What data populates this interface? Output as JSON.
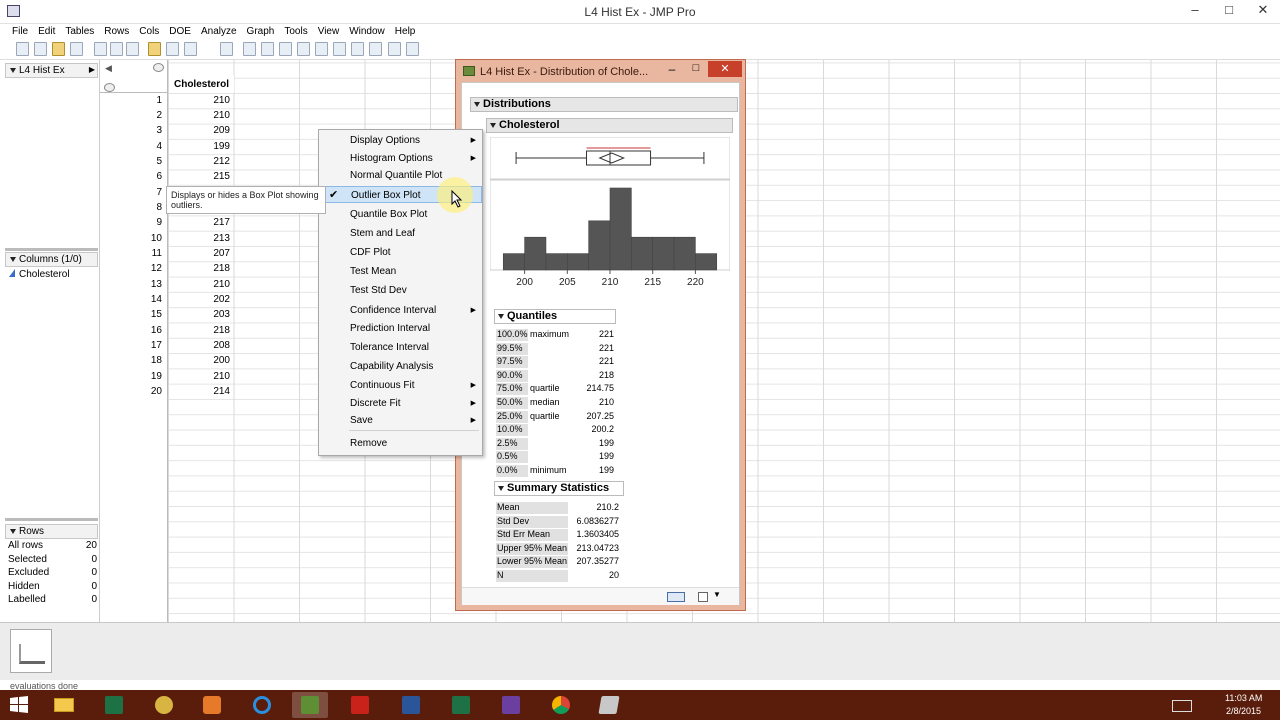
{
  "window": {
    "title": "L4 Hist Ex - JMP Pro"
  },
  "menubar": [
    "File",
    "Edit",
    "Tables",
    "Rows",
    "Cols",
    "DOE",
    "Analyze",
    "Graph",
    "Tools",
    "View",
    "Window",
    "Help"
  ],
  "table_panel": {
    "name": "L4 Hist Ex"
  },
  "columns_panel": {
    "title": "Columns (1/0)",
    "items": [
      "Cholesterol"
    ]
  },
  "rows_panel": {
    "title": "Rows",
    "items": [
      {
        "label": "All rows",
        "value": "20"
      },
      {
        "label": "Selected",
        "value": "0"
      },
      {
        "label": "Excluded",
        "value": "0"
      },
      {
        "label": "Hidden",
        "value": "0"
      },
      {
        "label": "Labelled",
        "value": "0"
      }
    ]
  },
  "datatable": {
    "column": "Cholesterol",
    "rows": [
      "1",
      "2",
      "3",
      "4",
      "5",
      "6",
      "7",
      "8",
      "9",
      "10",
      "11",
      "12",
      "13",
      "14",
      "15",
      "16",
      "17",
      "18",
      "19",
      "20"
    ],
    "values": [
      "210",
      "210",
      "209",
      "199",
      "212",
      "215",
      "",
      "",
      "217",
      "213",
      "207",
      "218",
      "210",
      "202",
      "203",
      "218",
      "208",
      "200",
      "210",
      "214"
    ]
  },
  "dist_window": {
    "title": "L4 Hist Ex - Distribution of Chole...",
    "distributions_label": "Distributions",
    "variable": "Cholesterol",
    "quantiles_title": "Quantiles",
    "quantiles": [
      {
        "p": "100.0%",
        "label": "maximum",
        "value": "221"
      },
      {
        "p": "99.5%",
        "label": "",
        "value": "221"
      },
      {
        "p": "97.5%",
        "label": "",
        "value": "221"
      },
      {
        "p": "90.0%",
        "label": "",
        "value": "218"
      },
      {
        "p": "75.0%",
        "label": "quartile",
        "value": "214.75"
      },
      {
        "p": "50.0%",
        "label": "median",
        "value": "210"
      },
      {
        "p": "25.0%",
        "label": "quartile",
        "value": "207.25"
      },
      {
        "p": "10.0%",
        "label": "",
        "value": "200.2"
      },
      {
        "p": "2.5%",
        "label": "",
        "value": "199"
      },
      {
        "p": "0.5%",
        "label": "",
        "value": "199"
      },
      {
        "p": "0.0%",
        "label": "minimum",
        "value": "199"
      }
    ],
    "summary_title": "Summary Statistics",
    "summary": [
      {
        "k": "Mean",
        "v": "210.2"
      },
      {
        "k": "Std Dev",
        "v": "6.0836277"
      },
      {
        "k": "Std Err Mean",
        "v": "1.3603405"
      },
      {
        "k": "Upper 95% Mean",
        "v": "213.04723"
      },
      {
        "k": "Lower 95% Mean",
        "v": "207.35277"
      },
      {
        "k": "N",
        "v": "20"
      }
    ]
  },
  "chart_data": {
    "type": "bar",
    "x_ticks": [
      "200",
      "205",
      "210",
      "215",
      "220"
    ],
    "bins": [
      {
        "x0": 197.5,
        "x1": 200,
        "count": 1
      },
      {
        "x0": 200,
        "x1": 202.5,
        "count": 2
      },
      {
        "x0": 202.5,
        "x1": 205,
        "count": 1
      },
      {
        "x0": 205,
        "x1": 207.5,
        "count": 1
      },
      {
        "x0": 207.5,
        "x1": 210,
        "count": 3
      },
      {
        "x0": 210,
        "x1": 212.5,
        "count": 5
      },
      {
        "x0": 212.5,
        "x1": 215,
        "count": 2
      },
      {
        "x0": 215,
        "x1": 217.5,
        "count": 2
      },
      {
        "x0": 217.5,
        "x1": 220,
        "count": 2
      },
      {
        "x0": 220,
        "x1": 222.5,
        "count": 1
      }
    ],
    "xlim": [
      197,
      223
    ],
    "boxplot": {
      "min": 199,
      "q1": 207.25,
      "median": 210,
      "q3": 214.75,
      "max": 221,
      "mean": 210.2
    }
  },
  "context_menu": {
    "items": [
      {
        "label": "Display Options",
        "submenu": true,
        "checked": false,
        "selected": false
      },
      {
        "label": "Histogram Options",
        "submenu": true,
        "checked": false,
        "selected": false
      },
      {
        "label": "Normal Quantile Plot",
        "submenu": false,
        "checked": false,
        "selected": false
      },
      {
        "label": "Outlier Box Plot",
        "submenu": false,
        "checked": true,
        "selected": true
      },
      {
        "label": "Quantile Box Plot",
        "submenu": false,
        "checked": false,
        "selected": false
      },
      {
        "label": "Stem and Leaf",
        "submenu": false,
        "checked": false,
        "selected": false
      },
      {
        "label": "CDF Plot",
        "submenu": false,
        "checked": false,
        "selected": false
      },
      {
        "label": "Test Mean",
        "submenu": false,
        "checked": false,
        "selected": false
      },
      {
        "label": "Test Std Dev",
        "submenu": false,
        "checked": false,
        "selected": false
      },
      {
        "label": "Confidence Interval",
        "submenu": true,
        "checked": false,
        "selected": false
      },
      {
        "label": "Prediction Interval",
        "submenu": false,
        "checked": false,
        "selected": false
      },
      {
        "label": "Tolerance Interval",
        "submenu": false,
        "checked": false,
        "selected": false
      },
      {
        "label": "Capability Analysis",
        "submenu": false,
        "checked": false,
        "selected": false
      },
      {
        "label": "Continuous Fit",
        "submenu": true,
        "checked": false,
        "selected": false
      },
      {
        "label": "Discrete Fit",
        "submenu": true,
        "checked": false,
        "selected": false
      },
      {
        "label": "Save",
        "submenu": true,
        "checked": false,
        "selected": false
      },
      {
        "label": "Remove",
        "submenu": false,
        "checked": false,
        "selected": false
      }
    ]
  },
  "tooltip": {
    "text": "Displays or hides a Box Plot showing outliers."
  },
  "status": {
    "text": "evaluations done"
  },
  "clock": {
    "time": "11:03 AM",
    "date": "2/8/2015"
  },
  "colors": {
    "taskbar": "#5a1d0b",
    "window_frame": "#e9b6a0",
    "histogram_bar": "#555555",
    "menu_highlight": "#cfe4f7"
  },
  "taskbar_icons": [
    "start-icon",
    "file-explorer-icon",
    "excel-icon",
    "app-icon",
    "media-icon",
    "internet-explorer-icon",
    "jmp-icon",
    "acrobat-icon",
    "word-icon",
    "excel-icon",
    "teams-icon",
    "chrome-icon",
    "app-icon"
  ]
}
